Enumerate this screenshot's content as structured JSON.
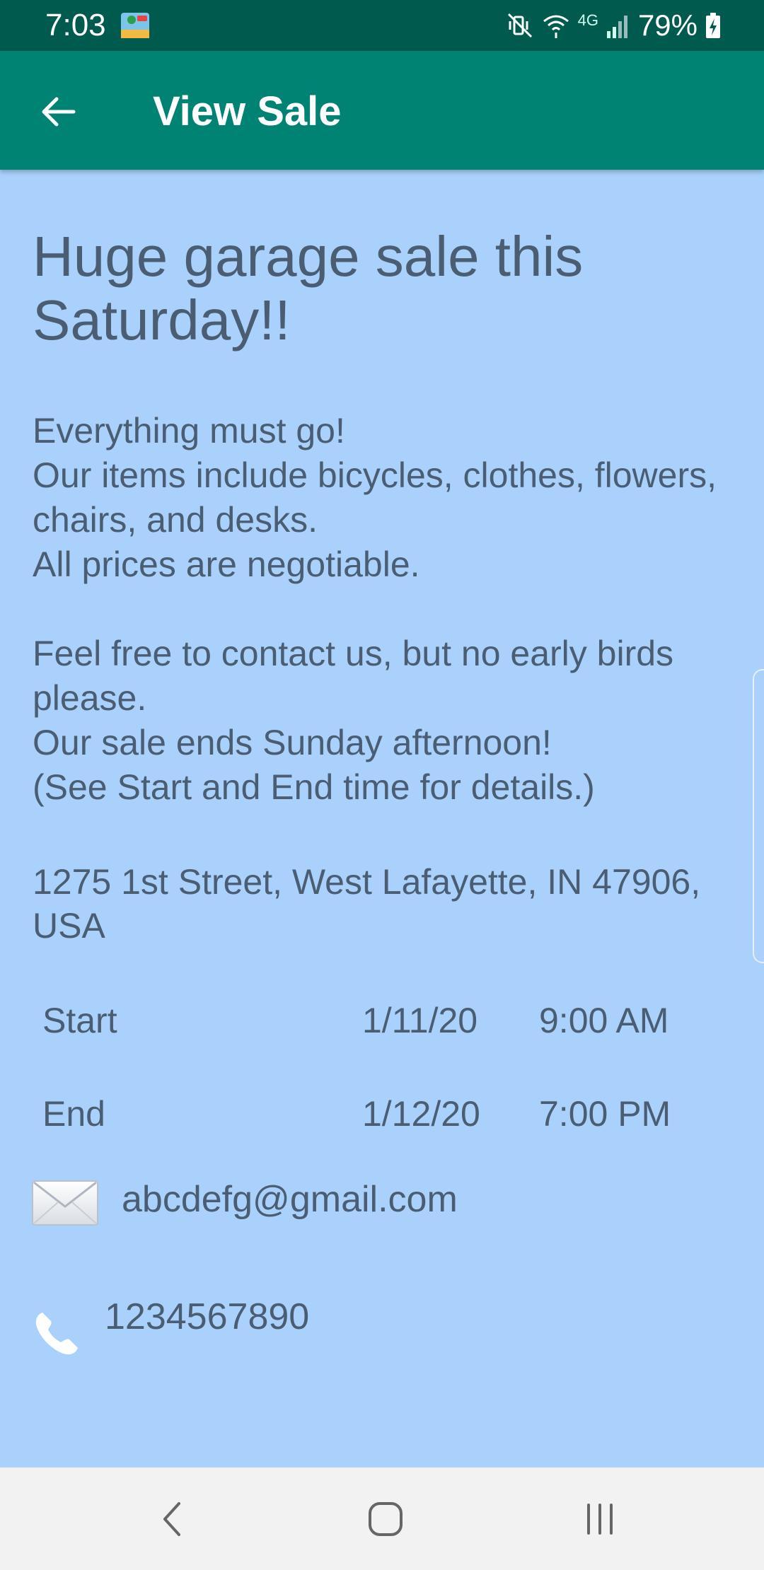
{
  "status_bar": {
    "time": "7:03",
    "network": "4G",
    "battery_percent": "79%",
    "icons": [
      "app-notification-icon",
      "mute-vibrate-icon",
      "wifi-icon",
      "signal-icon",
      "battery-charging-icon"
    ]
  },
  "app_bar": {
    "title": "View Sale",
    "back_icon": "arrow-back-icon",
    "background": "#008372",
    "status_background": "#005a4e"
  },
  "sale": {
    "title": "Huge garage sale this Saturday!!",
    "description": "Everything must go!\nOur items include bicycles, clothes, flowers, chairs, and desks.\nAll prices are negotiable.\n\nFeel free to contact us, but no early birds please.\nOur sale ends Sunday afternoon!\n(See Start and End time for details.)",
    "address": "1275 1st Street, West Lafayette, IN 47906, USA",
    "start": {
      "label": "Start",
      "date": "1/11/20",
      "time": "9:00 AM"
    },
    "end": {
      "label": "End",
      "date": "1/12/20",
      "time": "7:00 PM"
    },
    "email": "abcdefg@gmail.com",
    "phone": "1234567890"
  },
  "colors": {
    "page_background": "#aad1fb",
    "text": "#4a5d73",
    "nav_background": "#f2f2f2"
  },
  "nav_bar": {
    "icons": [
      "back-nav-icon",
      "home-icon",
      "recents-icon"
    ]
  }
}
